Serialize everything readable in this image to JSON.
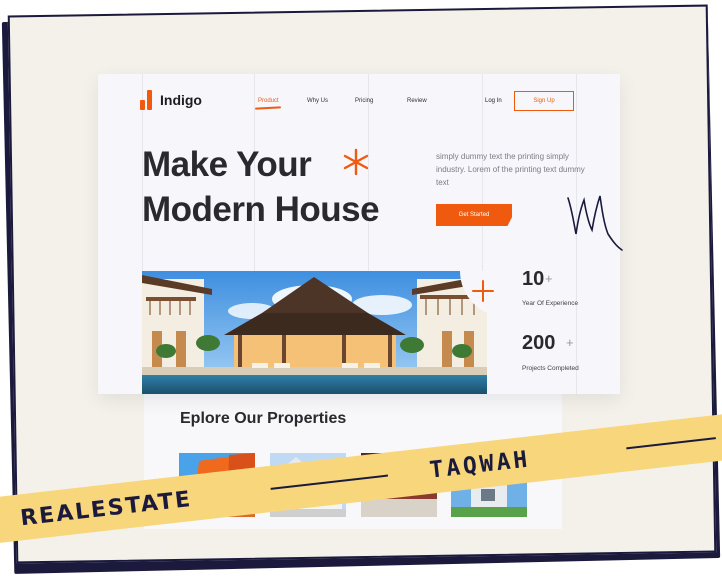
{
  "brand": {
    "name": "Indigo",
    "accent": "#f05a0f",
    "dark": "#1b1a3d"
  },
  "nav": {
    "items": [
      {
        "label": "Product",
        "active": true
      },
      {
        "label": "Why Us",
        "active": false
      },
      {
        "label": "Pricing",
        "active": false
      },
      {
        "label": "Review",
        "active": false
      }
    ],
    "login_label": "Log In",
    "signup_label": "Sign Up"
  },
  "hero": {
    "title_line1": "Make Your",
    "title_line2": "Modern House",
    "description": "simply dummy text the printing simply industry. Lorem of the printing text dummy text",
    "cta_label": "Get Started"
  },
  "stats": [
    {
      "number": "10",
      "suffix": "+",
      "label": "Year Of Experience"
    },
    {
      "number": "200",
      "suffix": "+",
      "label": "Projects Completed"
    }
  ],
  "properties": {
    "heading": "Eplore Our Properties"
  },
  "banner": {
    "left_text": "REALESTATE",
    "right_text": "TAQWAH"
  },
  "icons": [
    "logo-mark-icon",
    "orange-star-icon",
    "plus-star-icon",
    "scribble-icon"
  ]
}
